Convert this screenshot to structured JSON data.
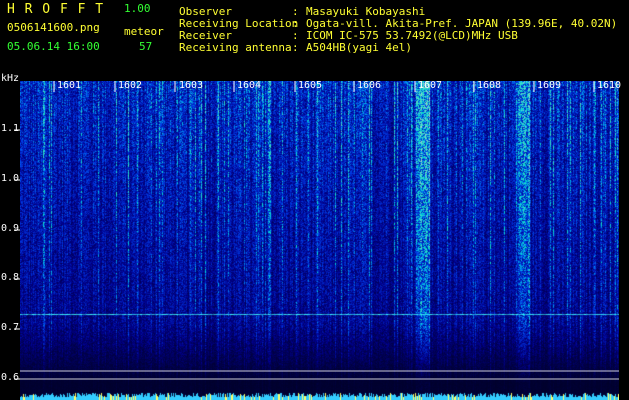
{
  "header": {
    "logo": "H R O F F T",
    "version": "1.00",
    "filename": "0506141600.png",
    "datetime": "05.06.14 16:00",
    "meteor_label": "meteor",
    "meteor_count": "57",
    "info": [
      {
        "label": "Observer",
        "sep": ":",
        "value": "Masayuki Kobayashi"
      },
      {
        "label": "Receiving Location",
        "sep": ":",
        "value": "Ogata-vill. Akita-Pref. JAPAN (139.96E, 40.02N)"
      },
      {
        "label": "Receiver",
        "sep": ":",
        "value": "ICOM IC-575 53.7492(@LCD)MHz USB"
      },
      {
        "label": "Receiving antenna",
        "sep": ":",
        "value": "A504HB(yagi 4el)"
      }
    ]
  },
  "axis": {
    "y_unit": "kHz",
    "y_ticks": [
      "1.1",
      "1.0",
      "0.9",
      "0.8",
      "0.7",
      "0.6"
    ],
    "time_labels": [
      "1601",
      "1602",
      "1603",
      "1604",
      "1605",
      "1606",
      "1607",
      "1608",
      "1609",
      "1610"
    ]
  },
  "colors": {
    "background": "#000000",
    "label": "#ffff33",
    "value": "#33ff33",
    "spectrum_base": "#0a1a8a",
    "meteor_trace": "#40ffff"
  }
}
